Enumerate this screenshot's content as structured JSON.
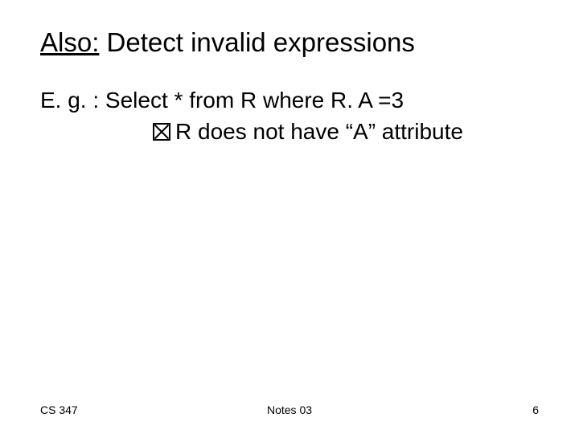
{
  "title": {
    "underlined": "Also:",
    "rest": " Detect invalid expressions"
  },
  "body": {
    "line1": "E. g. :  Select * from R where R. A =3",
    "line2": "R does not have “A” attribute"
  },
  "footer": {
    "left": "CS 347",
    "center": "Notes 03",
    "page": "6"
  }
}
